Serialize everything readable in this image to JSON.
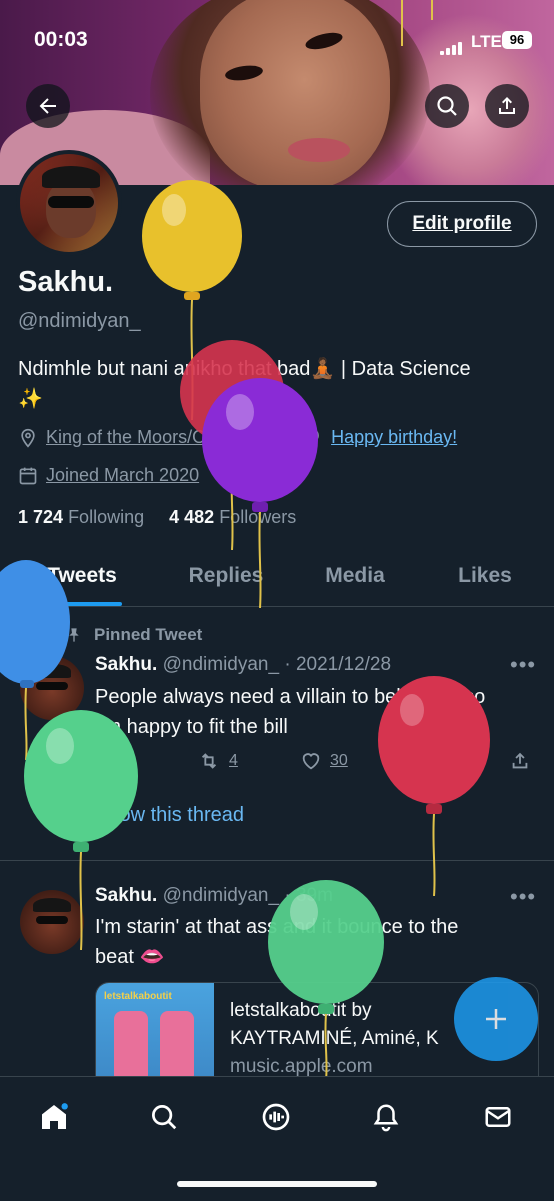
{
  "status_bar": {
    "time": "00:03",
    "network": "LTE",
    "battery": "96"
  },
  "profile": {
    "edit_label": "Edit profile",
    "name": "Sakhu.",
    "handle": "@ndimidyan_",
    "bio_line1": "Ndimhle but nani anikho that bad🧘🏾 | Data Science",
    "bio_line2": "✨",
    "location": "King of the Moors/Osmir/CPT",
    "birthday": "Happy birthday!",
    "joined": "Joined March 2020",
    "following_count": "1 724",
    "following_label": "Following",
    "followers_count": "4 482",
    "followers_label": "Followers"
  },
  "tabs": [
    "Tweets",
    "Replies",
    "Media",
    "Likes"
  ],
  "tweets": [
    {
      "pinned_label": "Pinned Tweet",
      "name": "Sakhu.",
      "handle": "@ndimidyan_",
      "time": "· 2021/12/28",
      "line1": "People always need a villain to believe in so",
      "line2": "I'm happy to fit the bill",
      "replies": "2",
      "retweets": "4",
      "likes": "30",
      "show_thread": "Show this thread"
    },
    {
      "name": "Sakhu.",
      "handle": "@ndimidyan_",
      "time": "· 39m",
      "line1": "I'm starin' at that ass and it bounce to the",
      "line2": "beat 👄",
      "card": {
        "title1": "letstalkaboutit by",
        "title2": "KAYTRAMINÉ, Aminé, K",
        "domain": "music.apple.com",
        "art_text": "letstalkaboutit"
      }
    }
  ],
  "colors": {
    "background": "#15202b",
    "accent": "#1d9bf0",
    "link": "#6ab8f2",
    "muted": "#8b98a5",
    "balloon_yellow": "#e8c12c",
    "balloon_red": "#d6344f",
    "balloon_purple": "#8a2bd6",
    "balloon_blue": "#3f8fe6",
    "balloon_green": "#55d08c"
  },
  "icons": [
    "back-arrow-icon",
    "search-icon",
    "share-icon",
    "location-pin-icon",
    "balloon-icon",
    "calendar-icon",
    "pin-icon",
    "reply-icon",
    "retweet-icon",
    "heart-icon",
    "analytics-icon",
    "upload-icon",
    "plus-icon",
    "home-icon",
    "spaces-icon",
    "bell-icon",
    "mail-icon"
  ]
}
